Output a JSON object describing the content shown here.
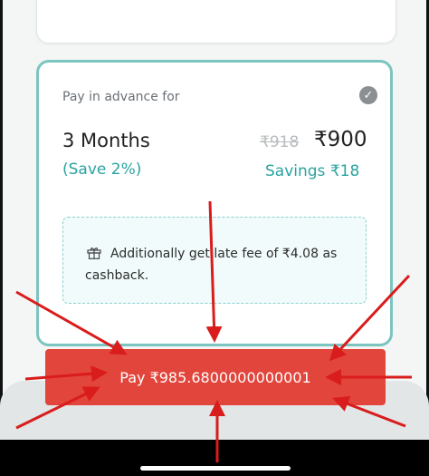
{
  "plan_card": {
    "title": "Pay in advance for",
    "duration": "3 Months",
    "save_percent": "(Save 2%)",
    "old_price": "₹918",
    "new_price": "₹900",
    "savings": "Savings ₹18",
    "selected": true,
    "check_icon": "check-circle-icon"
  },
  "cashback": {
    "icon": "gift-icon",
    "text": "Additionally get late fee of ₹4.08 as cashback."
  },
  "pay_button": {
    "label": "Pay ₹985.6800000000001"
  },
  "colors": {
    "accent_teal": "#2aa3a1",
    "card_border": "#7cc4c0",
    "pay_button": "#e2453b",
    "annotation_arrow": "#d91c1c"
  }
}
